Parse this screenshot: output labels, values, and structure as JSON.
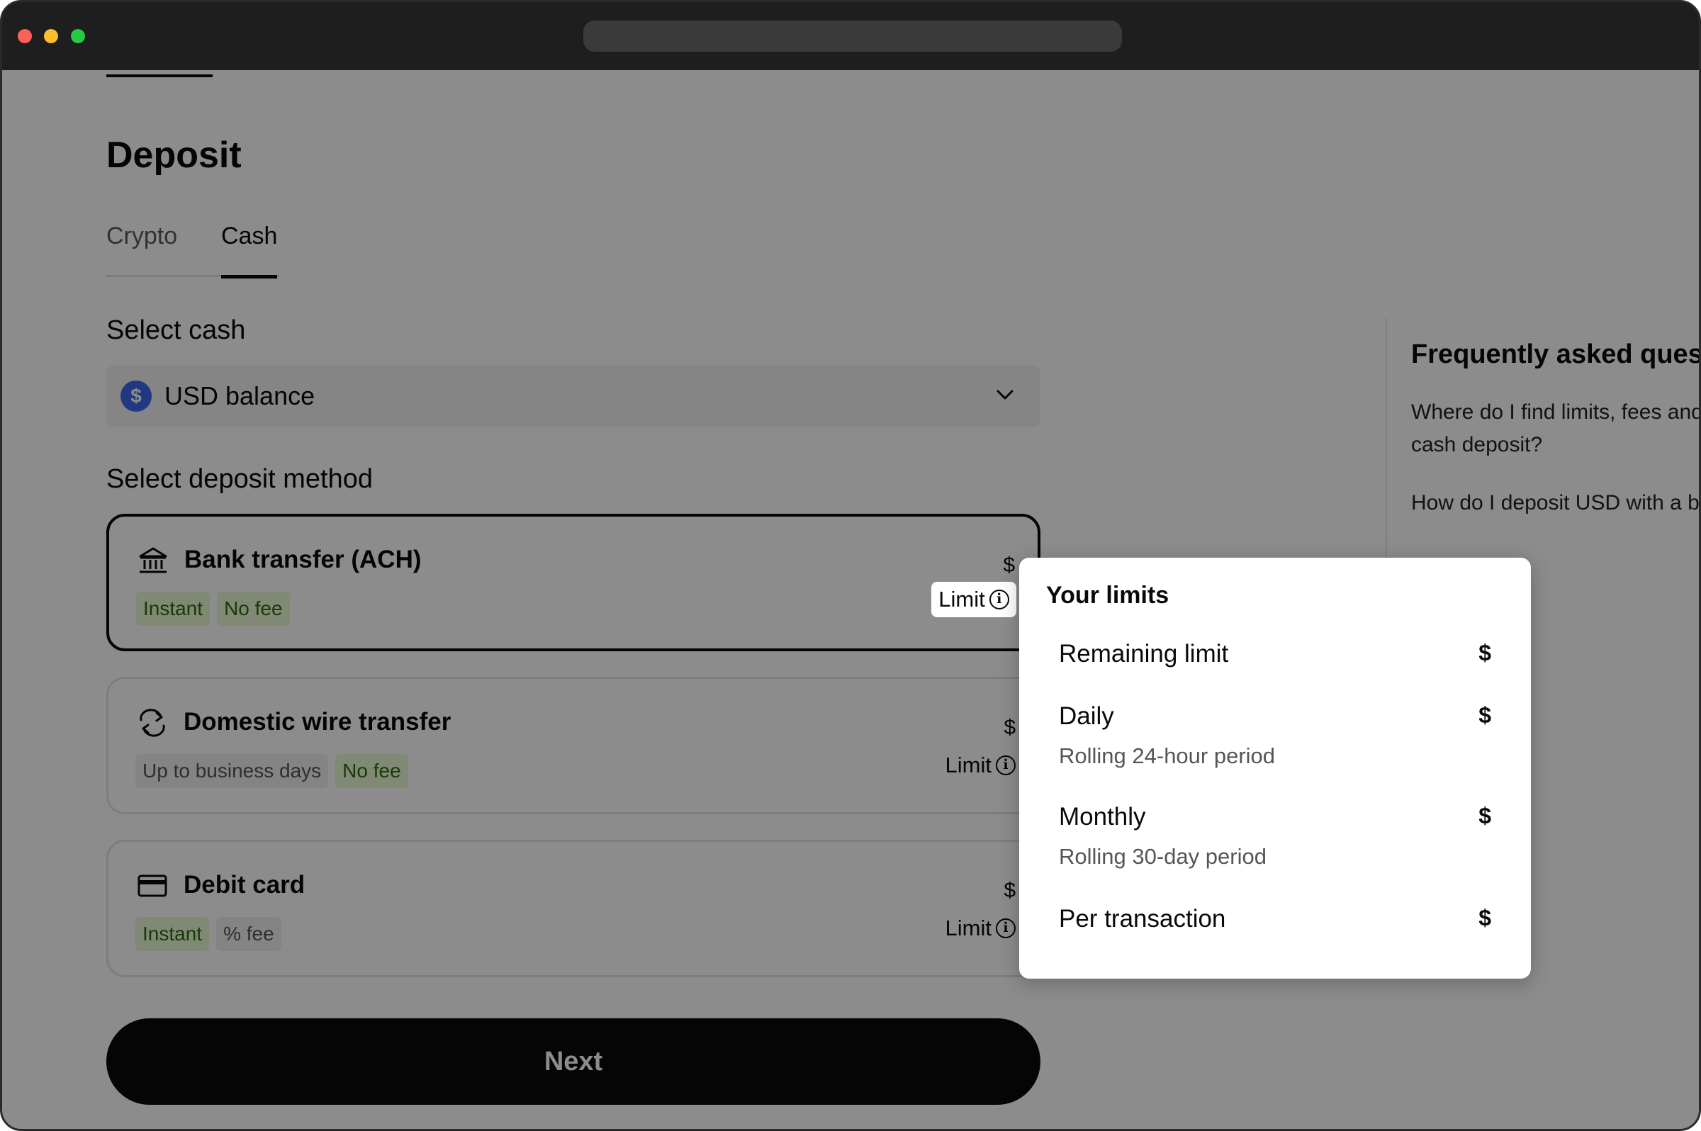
{
  "page": {
    "title": "Deposit",
    "tabs": [
      {
        "label": "Crypto",
        "active": false
      },
      {
        "label": "Cash",
        "active": true
      }
    ]
  },
  "select_cash": {
    "label": "Select cash",
    "value": "USD balance",
    "icon": "dollar-icon",
    "accent": "#3c66ee"
  },
  "deposit_method": {
    "label": "Select deposit method",
    "methods": [
      {
        "title": "Bank transfer (ACH)",
        "icon": "bank-icon",
        "badges": [
          "Instant",
          "No fee"
        ],
        "amount": "$",
        "limit_label": "Limit",
        "selected": true
      },
      {
        "title": "Domestic wire transfer",
        "icon": "transfer-arrows-icon",
        "badges": [
          "Up to  business days",
          "No fee"
        ],
        "amount": "$",
        "limit_label": "Limit",
        "selected": false
      },
      {
        "title": "Debit card",
        "icon": "credit-card-icon",
        "badges": [
          "Instant",
          "% fee"
        ],
        "amount": "$",
        "limit_label": "Limit",
        "selected": false
      }
    ]
  },
  "next_button": {
    "label": "Next"
  },
  "faq": {
    "title": "Frequently asked questions",
    "questions": [
      "Where do I find limits, fees and",
      "cash deposit?",
      "How do I deposit USD with a b"
    ]
  },
  "limits_popover": {
    "title": "Your limits",
    "rows": [
      {
        "label": "Remaining limit",
        "sub": "",
        "value": "$"
      },
      {
        "label": "Daily",
        "sub": "Rolling 24-hour period",
        "value": "$"
      },
      {
        "label": "Monthly",
        "sub": "Rolling 30-day period",
        "value": "$"
      },
      {
        "label": "Per transaction",
        "sub": "",
        "value": "$"
      }
    ]
  },
  "colors": {
    "badge_green_bg": "#e7f9d4",
    "badge_green_text": "#2f6b10",
    "primary": "#0a0a0a"
  }
}
